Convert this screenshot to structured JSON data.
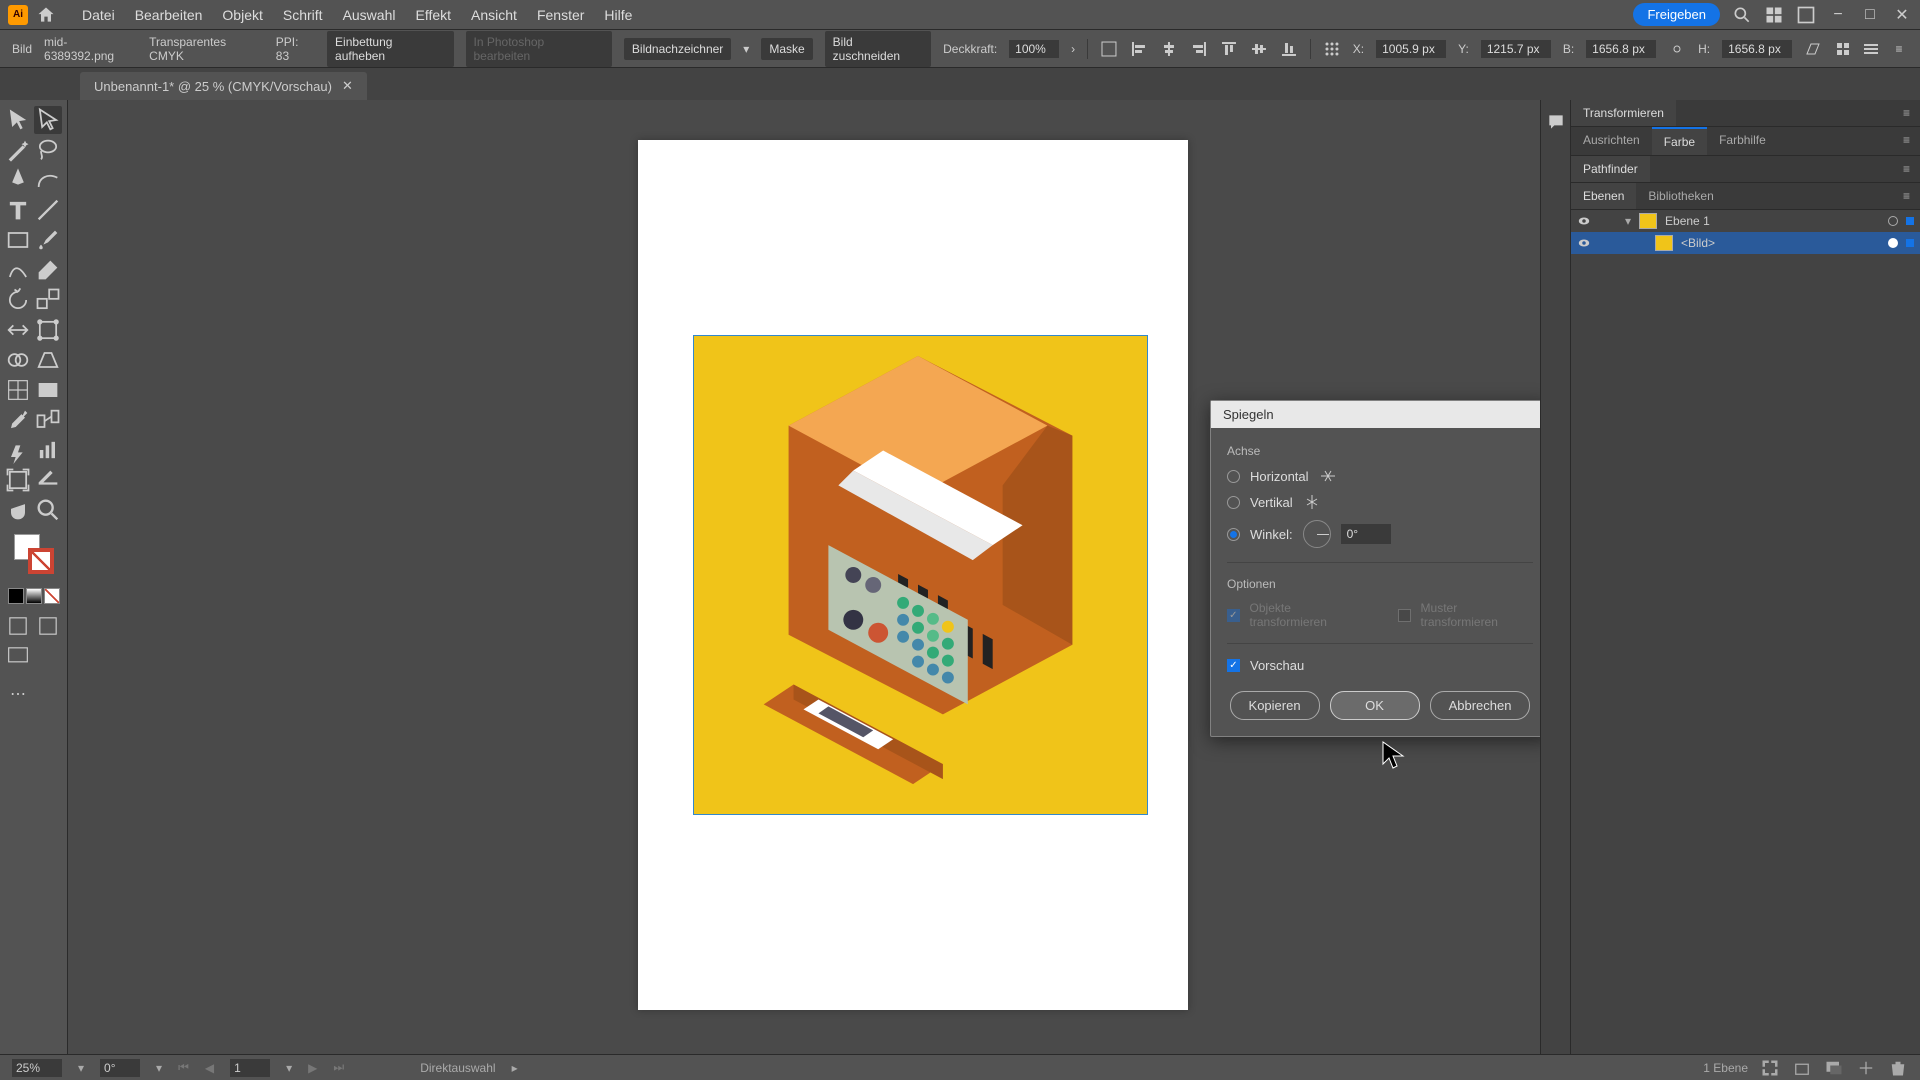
{
  "menubar": {
    "app_abbr": "Ai",
    "items": [
      "Datei",
      "Bearbeiten",
      "Objekt",
      "Schrift",
      "Auswahl",
      "Effekt",
      "Ansicht",
      "Fenster",
      "Hilfe"
    ],
    "share_label": "Freigeben"
  },
  "controlbar": {
    "type_label": "Bild",
    "filename": "mid-6389392.png",
    "colorspace": "Transparentes CMYK",
    "ppi_label": "PPI:",
    "ppi_value": "83",
    "unembed": "Einbettung aufheben",
    "edit_in_ps": "In Photoshop bearbeiten",
    "trace": "Bildnachzeichner",
    "mask": "Maske",
    "crop": "Bild zuschneiden",
    "opacity_label": "Deckkraft:",
    "opacity_value": "100%",
    "x_label": "X:",
    "x_value": "1005.9 px",
    "y_label": "Y:",
    "y_value": "1215.7 px",
    "w_label": "B:",
    "w_value": "1656.8 px",
    "h_label": "H:",
    "h_value": "1656.8 px"
  },
  "tabbar": {
    "doc_name": "Unbenannt-1* @ 25 % (CMYK/Vorschau)"
  },
  "dialog": {
    "title": "Spiegeln",
    "axis_section": "Achse",
    "horizontal": "Horizontal",
    "vertical": "Vertikal",
    "angle_label": "Winkel:",
    "angle_value": "0°",
    "options_section": "Optionen",
    "transform_objects": "Objekte transformieren",
    "transform_patterns": "Muster transformieren",
    "preview": "Vorschau",
    "copy": "Kopieren",
    "ok": "OK",
    "cancel": "Abbrechen"
  },
  "panels": {
    "transform_tab": "Transformieren",
    "align_tab": "Ausrichten",
    "color_tab": "Farbe",
    "colorguide_tab": "Farbhilfe",
    "pathfinder_tab": "Pathfinder",
    "layers_tab": "Ebenen",
    "libraries_tab": "Bibliotheken",
    "layer1_name": "Ebene 1",
    "image_item": "<Bild>"
  },
  "statusbar": {
    "zoom": "25%",
    "rotation": "0°",
    "artboard_num": "1",
    "tool_name": "Direktauswahl",
    "layer_count": "1 Ebene"
  }
}
